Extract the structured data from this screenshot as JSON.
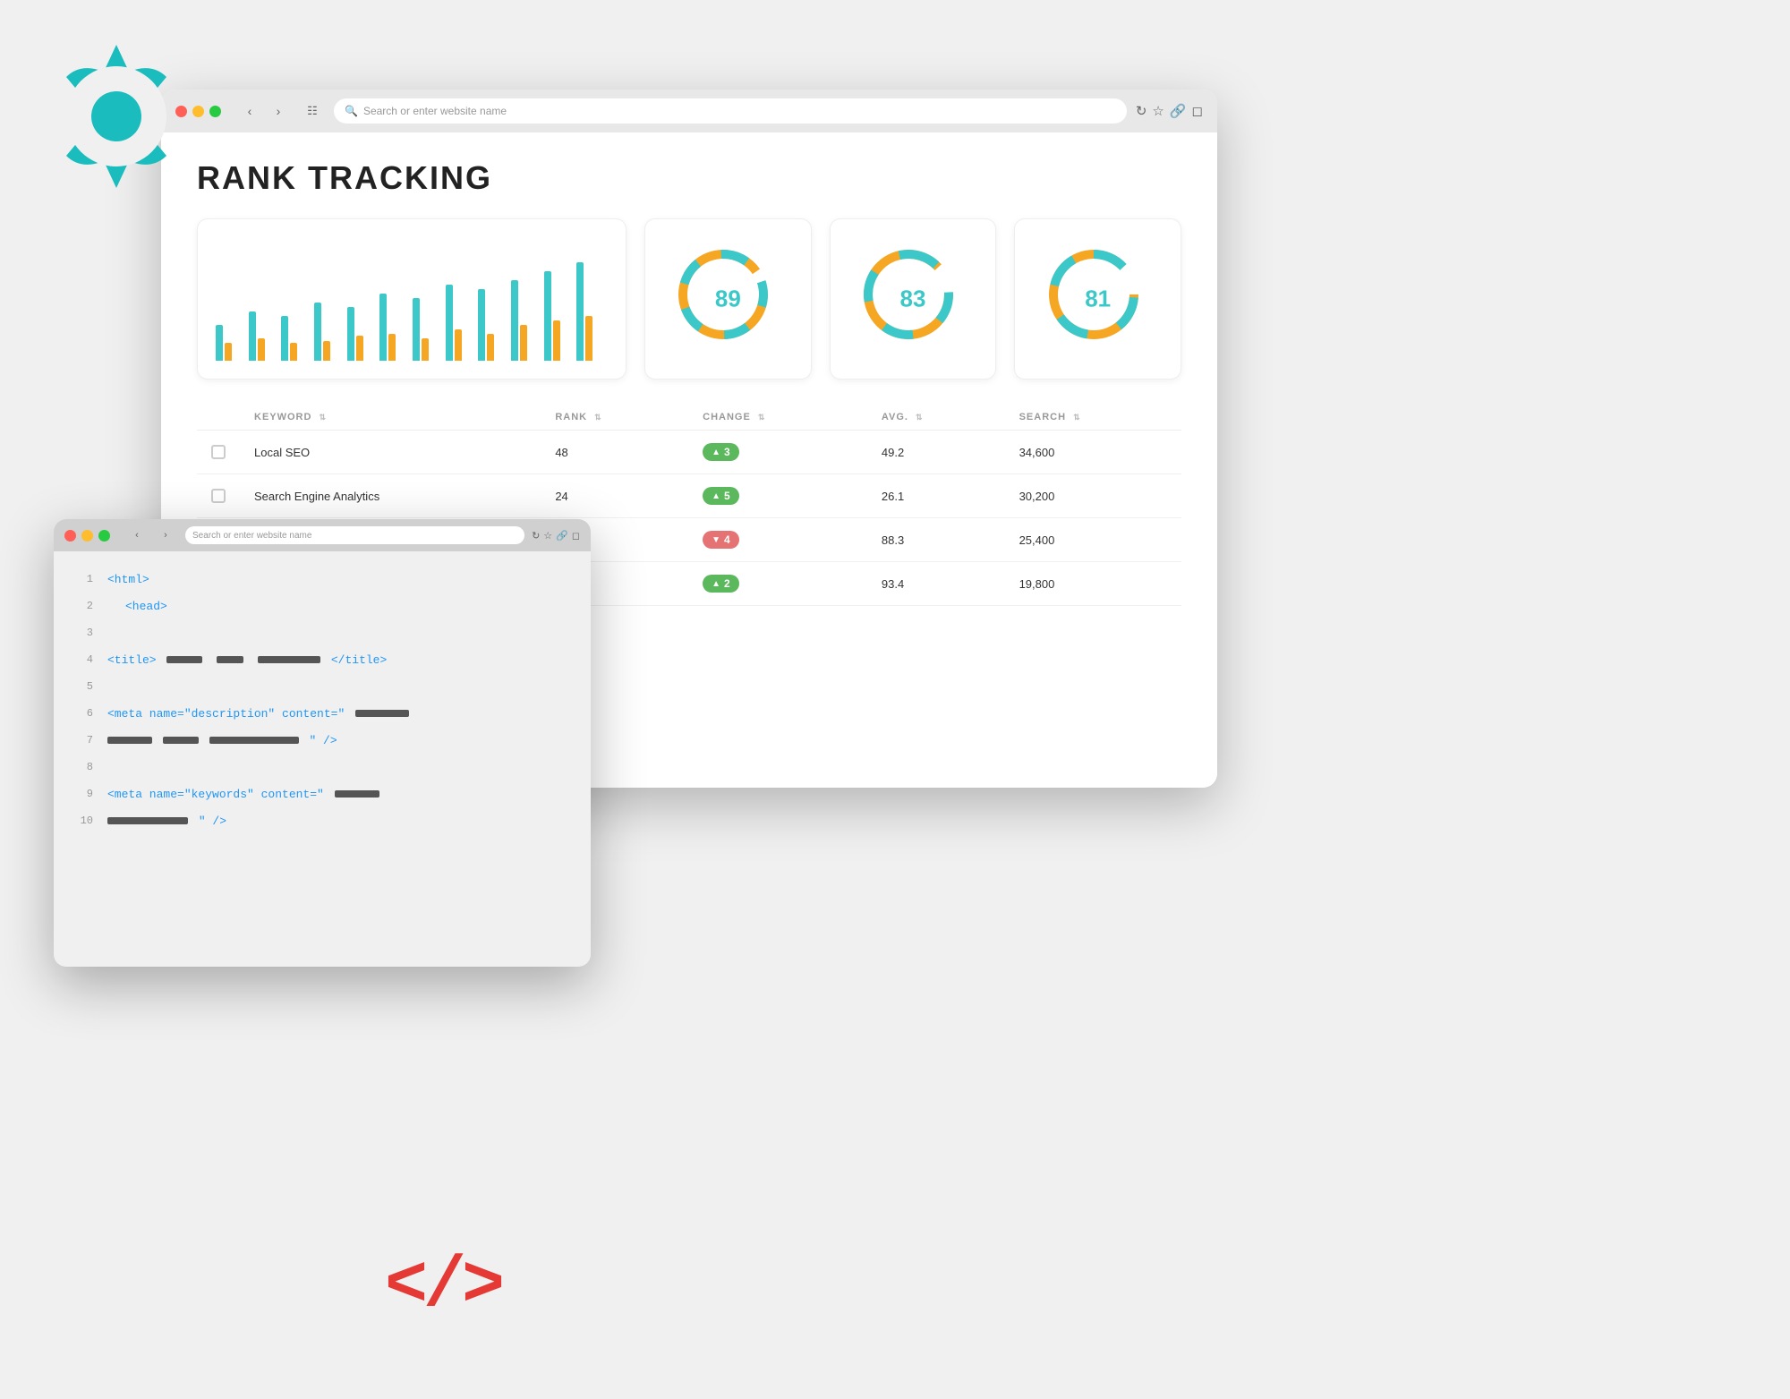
{
  "page": {
    "title": "Rank Tracking",
    "background_color": "#f0f0f0"
  },
  "main_browser": {
    "search_placeholder": "Search or enter website name",
    "page_heading": "RANK TRACKING"
  },
  "gauges": [
    {
      "value": 89,
      "color": "#3cc8c8",
      "track_color": "#f5a623"
    },
    {
      "value": 83,
      "color": "#3cc8c8",
      "track_color": "#f5a623"
    },
    {
      "value": 81,
      "color": "#3cc8c8",
      "track_color": "#f5a623"
    }
  ],
  "table": {
    "headers": [
      "KEYWORD",
      "RANK",
      "CHANGE",
      "AVG.",
      "SEARCH"
    ],
    "rows": [
      {
        "keyword": "Local SEO",
        "rank": "48",
        "change": "+3",
        "change_type": "positive",
        "avg": "49.2",
        "search": "34,600"
      },
      {
        "keyword": "Search Engine Analytics",
        "rank": "24",
        "change": "+5",
        "change_type": "positive",
        "avg": "26.1",
        "search": "30,200"
      },
      {
        "keyword": "",
        "rank": "",
        "change": "-4",
        "change_type": "negative",
        "avg": "88.3",
        "search": "25,400"
      },
      {
        "keyword": "",
        "rank": "",
        "change": "+2",
        "change_type": "positive",
        "avg": "93.4",
        "search": "19,800"
      }
    ]
  },
  "bar_chart": {
    "groups": [
      {
        "teal_h": 40,
        "orange_h": 20
      },
      {
        "teal_h": 55,
        "orange_h": 25
      },
      {
        "teal_h": 50,
        "orange_h": 20
      },
      {
        "teal_h": 65,
        "orange_h": 22
      },
      {
        "teal_h": 60,
        "orange_h": 28
      },
      {
        "teal_h": 75,
        "orange_h": 30
      },
      {
        "teal_h": 70,
        "orange_h": 25
      },
      {
        "teal_h": 85,
        "orange_h": 35
      },
      {
        "teal_h": 80,
        "orange_h": 30
      },
      {
        "teal_h": 90,
        "orange_h": 40
      },
      {
        "teal_h": 100,
        "orange_h": 45
      },
      {
        "teal_h": 110,
        "orange_h": 50
      }
    ]
  },
  "code_window": {
    "search_placeholder": "Search or enter website name",
    "lines": [
      {
        "num": 1,
        "content": "&lt;html&gt;",
        "type": "tag"
      },
      {
        "num": 2,
        "content": "&lt;head&gt;",
        "type": "tag",
        "indent": true
      },
      {
        "num": 3,
        "content": "",
        "type": "blank"
      },
      {
        "num": 4,
        "content": "&lt;title&gt;",
        "type": "tag_with_redacted",
        "suffix": "&lt;/title&gt;"
      },
      {
        "num": 5,
        "content": "",
        "type": "blank"
      },
      {
        "num": 6,
        "content": "&lt;meta name=\"description\" content=\"",
        "type": "attr"
      },
      {
        "num": 7,
        "content": "",
        "type": "redacted_line",
        "suffix": "\" /&gt;"
      },
      {
        "num": 8,
        "content": "",
        "type": "blank"
      },
      {
        "num": 9,
        "content": "&lt;meta name=\"keywords\" content=\"",
        "type": "attr"
      },
      {
        "num": 10,
        "content": "",
        "type": "redacted_line",
        "suffix": "\" /&gt;"
      }
    ]
  },
  "code_symbols": {
    "text": "</>"
  }
}
